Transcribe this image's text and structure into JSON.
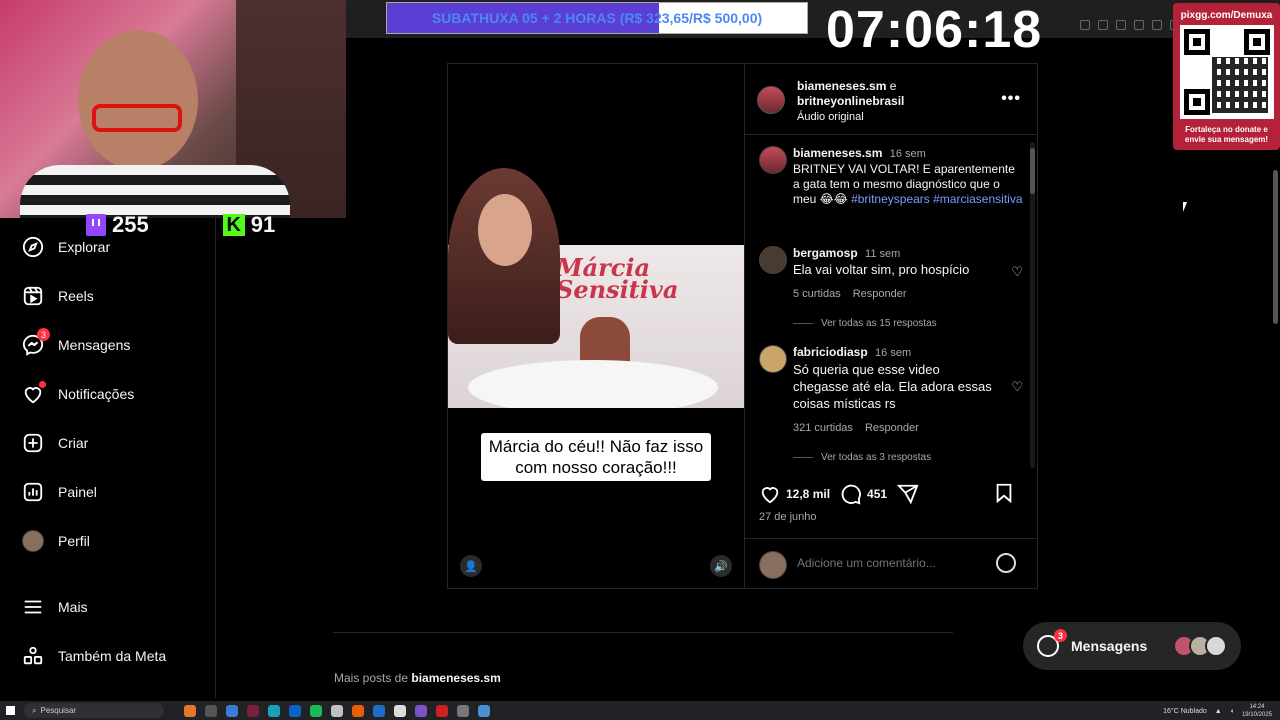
{
  "stream": {
    "donation_text": "SUBATHUXA 05 + 2 HORAS (R$ 323,65/R$ 500,00)",
    "donation_progress": 0.647,
    "clock": "07:06:18",
    "twitch_viewers": "255",
    "kick_viewers": "91",
    "kick_logo": "K",
    "qr_title": "pixgg.com/Demuxa",
    "qr_caption": "Fortaleça no donate e envie sua mensagem!"
  },
  "sidebar": {
    "items": [
      {
        "label": "Explorar",
        "icon": "compass-icon"
      },
      {
        "label": "Reels",
        "icon": "reels-icon"
      },
      {
        "label": "Mensagens",
        "icon": "messenger-icon",
        "badge": "3"
      },
      {
        "label": "Notificações",
        "icon": "heart-icon"
      },
      {
        "label": "Criar",
        "icon": "plus-square-icon"
      },
      {
        "label": "Painel",
        "icon": "chart-icon"
      },
      {
        "label": "Perfil",
        "icon": "avatar"
      },
      {
        "label": "Mais",
        "icon": "menu-icon"
      },
      {
        "label": "Também da Meta",
        "icon": "meta-grid-icon"
      }
    ]
  },
  "post": {
    "media": {
      "brand": "Márcia Sensitiva",
      "caption": "Márcia do céu!! Não faz isso com nosso coração!!!"
    },
    "header": {
      "author1": "biameneses.sm",
      "joiner": "e",
      "author2": "britneyonlinebrasil",
      "audio": "Áudio original"
    },
    "comments": [
      {
        "user": "biameneses.sm",
        "time": "16 sem",
        "text": "BRITNEY VAI VOLTAR! E aparentemente a gata tem o mesmo diagnóstico que o meu 😂😂",
        "tags": "#britneyspears #marciasensitiva"
      },
      {
        "user": "bergamosp",
        "time": "11 sem",
        "text": "Ela vai voltar sim, pro hospício",
        "likes": "5 curtidas",
        "reply": "Responder",
        "replies": "Ver todas as 15 respostas"
      },
      {
        "user": "fabriciodiasp",
        "time": "16 sem",
        "text": "Só queria que esse video chegasse até ela. Ela adora essas coisas místicas rs",
        "likes": "321 curtidas",
        "reply": "Responder",
        "replies": "Ver todas as 3 respostas"
      }
    ],
    "likes": "12,8 mil",
    "comment_count": "451",
    "date": "27 de junho",
    "comment_placeholder": "Adicione um comentário..."
  },
  "more_posts": {
    "prefix": "Mais posts de",
    "user": "biameneses.sm"
  },
  "messages_pill": {
    "label": "Mensagens",
    "badge": "3"
  },
  "taskbar": {
    "search": "Pesquisar",
    "weather": "16°C  Nublado",
    "time": "14:24",
    "date": "19/10/2025"
  }
}
